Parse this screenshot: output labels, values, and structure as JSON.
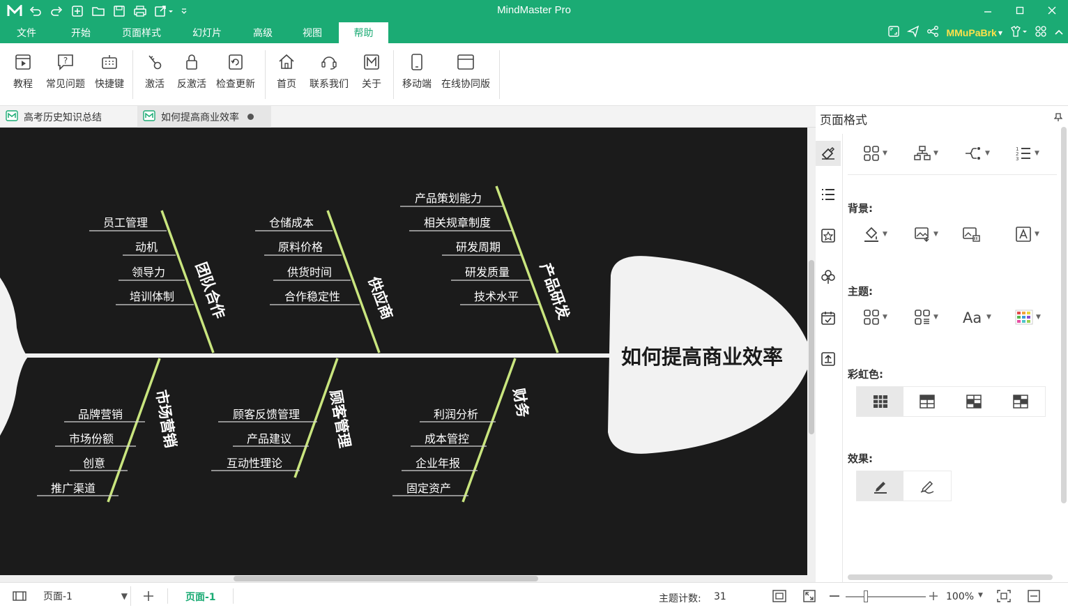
{
  "window": {
    "title": "MindMaster Pro"
  },
  "menu": {
    "items": [
      "文件",
      "开始",
      "页面样式",
      "幻灯片",
      "高级",
      "视图",
      "帮助"
    ],
    "active": "帮助",
    "user": "MMuPaBrk"
  },
  "ribbon": {
    "buttons": [
      "教程",
      "常见问题",
      "快捷键",
      "激活",
      "反激活",
      "检查更新",
      "首页",
      "联系我们",
      "关于",
      "移动端",
      "在线协同版"
    ]
  },
  "tabs": [
    {
      "label": "高考历史知识总结"
    },
    {
      "label": "如何提高商业效率"
    }
  ],
  "diagram": {
    "head": "如何提高商业效率",
    "branches": [
      {
        "label": "团队合作",
        "items": [
          "员工管理",
          "动机",
          "领导力",
          "培训体制"
        ]
      },
      {
        "label": "供应商",
        "items": [
          "仓储成本",
          "原料价格",
          "供货时间",
          "合作稳定性"
        ]
      },
      {
        "label": "产品研发",
        "items": [
          "产品策划能力",
          "相关规章制度",
          "研发周期",
          "研发质量",
          "技术水平"
        ]
      },
      {
        "label": "市场营销",
        "items": [
          "品牌营销",
          "市场份额",
          "创意",
          "推广渠道"
        ]
      },
      {
        "label": "顾客管理",
        "items": [
          "顾客反馈管理",
          "产品建议",
          "互动性理论"
        ]
      },
      {
        "label": "财务",
        "items": [
          "利润分析",
          "成本管控",
          "企业年报",
          "固定资产"
        ]
      }
    ]
  },
  "panel": {
    "title": "页面格式",
    "sections": {
      "background": "背景:",
      "theme": "主题:",
      "rainbow": "彩虹色:",
      "effect": "效果:"
    }
  },
  "status": {
    "page_select": "页面-1",
    "page_tab": "页面-1",
    "topic_count_label": "主题计数:",
    "topic_count": "31",
    "zoom": "100%"
  },
  "colors": {
    "brand": "#1bab74",
    "canvas_bg": "#1b1b1b",
    "bone": "#c9e57e",
    "user": "#ffe14a"
  }
}
